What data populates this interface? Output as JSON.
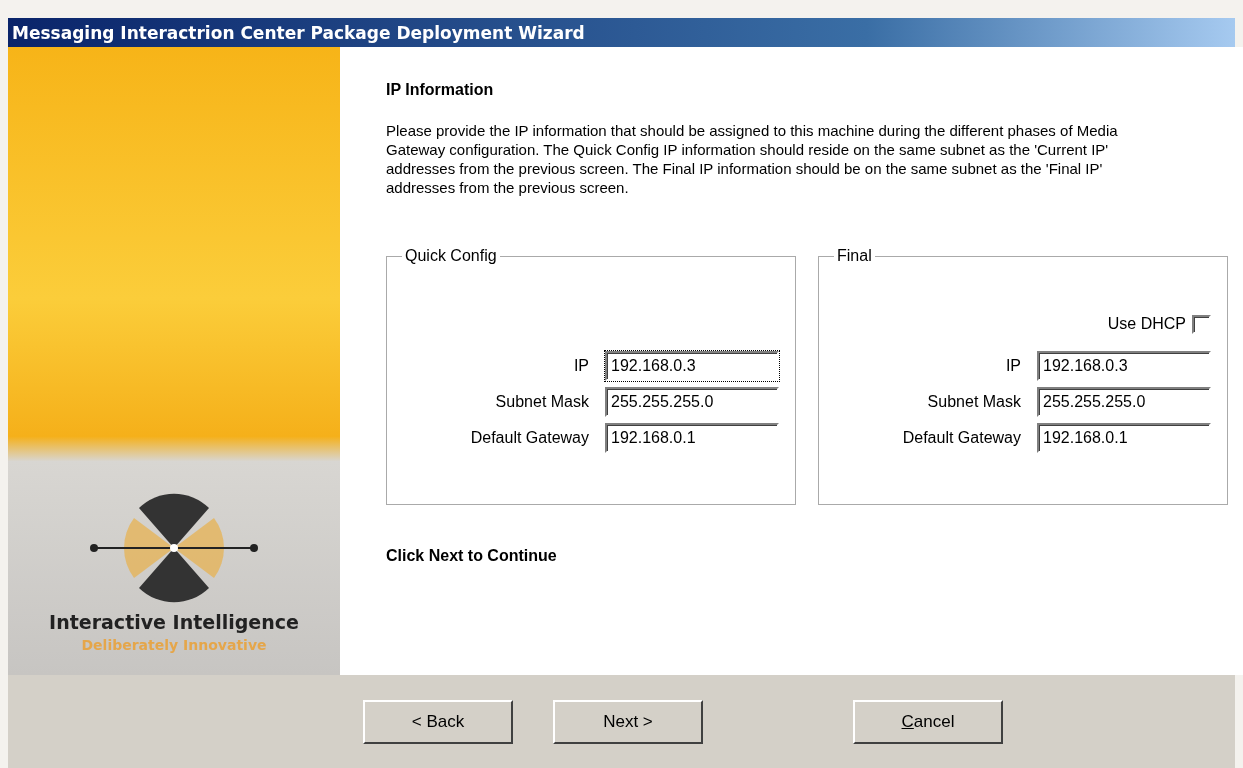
{
  "window": {
    "title": "Messaging Interactrion Center Package Deployment Wizard"
  },
  "banner": {
    "brand": "Interactive Intelligence",
    "tagline": "Deliberately Innovative"
  },
  "heading": "IP Information",
  "description": "Please provide the IP information that should be assigned to this machine during the different phases of Media Gateway configuration.  The Quick Config IP information should reside on the same subnet as the 'Current IP' addresses from the previous screen.  The Final IP information should be on the same subnet as the 'Final IP' addresses from the previous screen.",
  "groups": [
    {
      "title": "Quick Config",
      "fields": [
        {
          "label": "IP",
          "value": "192.168.0.3",
          "focused": true
        },
        {
          "label": "Subnet Mask",
          "value": "255.255.255.0",
          "focused": false
        },
        {
          "label": "Default Gateway",
          "value": "192.168.0.1",
          "focused": false
        }
      ]
    },
    {
      "title": "Final",
      "use_dhcp": {
        "label": "Use DHCP",
        "checked": false
      },
      "fields": [
        {
          "label": "IP",
          "value": "192.168.0.3",
          "focused": false
        },
        {
          "label": "Subnet Mask",
          "value": "255.255.255.0",
          "focused": false
        },
        {
          "label": "Default Gateway",
          "value": "192.168.0.1",
          "focused": false
        }
      ]
    }
  ],
  "footer_note": "Click Next to Continue",
  "buttons": [
    {
      "label": "< Back",
      "kind": "nav",
      "access_key": false
    },
    {
      "label": "Next >",
      "kind": "nav",
      "access_key": false
    },
    {
      "label": "Cancel",
      "kind": "cancel",
      "access_key": true
    }
  ]
}
